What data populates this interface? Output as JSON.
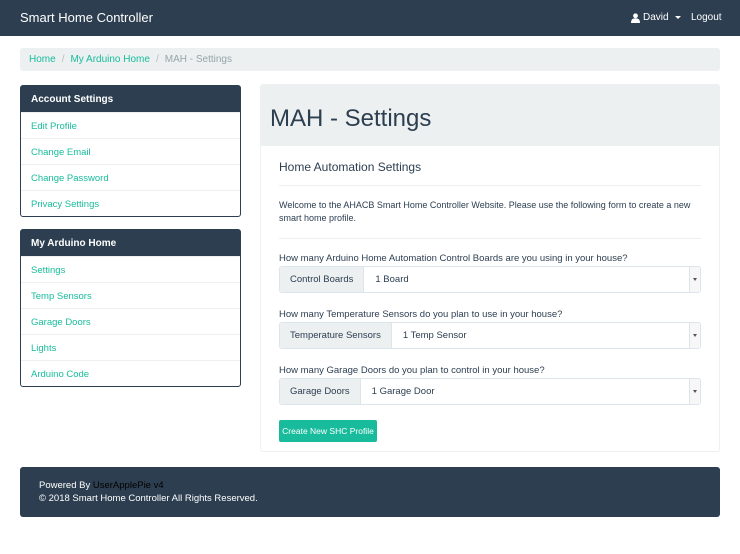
{
  "navbar": {
    "brand": "Smart Home Controller",
    "user": "David",
    "user_icon": "user-icon",
    "logout": "Logout"
  },
  "breadcrumb": {
    "items": [
      "Home",
      "My Arduino Home"
    ],
    "active": "MAH - Settings",
    "separator": "/"
  },
  "sidebar": {
    "account": {
      "title": "Account Settings",
      "items": [
        "Edit Profile",
        "Change Email",
        "Change Password",
        "Privacy Settings"
      ]
    },
    "arduino": {
      "title": "My Arduino Home",
      "items": [
        "Settings",
        "Temp Sensors",
        "Garage Doors",
        "Lights",
        "Arduino Code"
      ]
    }
  },
  "main": {
    "title": "MAH - Settings",
    "subtitle": "Home Automation Settings",
    "intro": "Welcome to the AHACB Smart Home Controller Website. Please use the following form to create a new smart home profile.",
    "questions": [
      {
        "label": "How many Arduino Home Automation Control Boards are you using in your house?",
        "addon": "Control Boards",
        "value": "1 Board"
      },
      {
        "label": "How many Temperature Sensors do you plan to use in your house?",
        "addon": "Temperature Sensors",
        "value": "1 Temp Sensor"
      },
      {
        "label": "How many Garage Doors do you plan to control in your house?",
        "addon": "Garage Doors",
        "value": "1 Garage Door"
      }
    ],
    "button": "Create New SHC Profile"
  },
  "footer": {
    "powered_prefix": "Powered By",
    "powered_link": "UserApplePie v4",
    "copyright": "© 2018 Smart Home Controller All Rights Reserved."
  },
  "colors": {
    "primary": "#2c3e50",
    "accent": "#18bc9c",
    "light": "#ecf0f1"
  }
}
